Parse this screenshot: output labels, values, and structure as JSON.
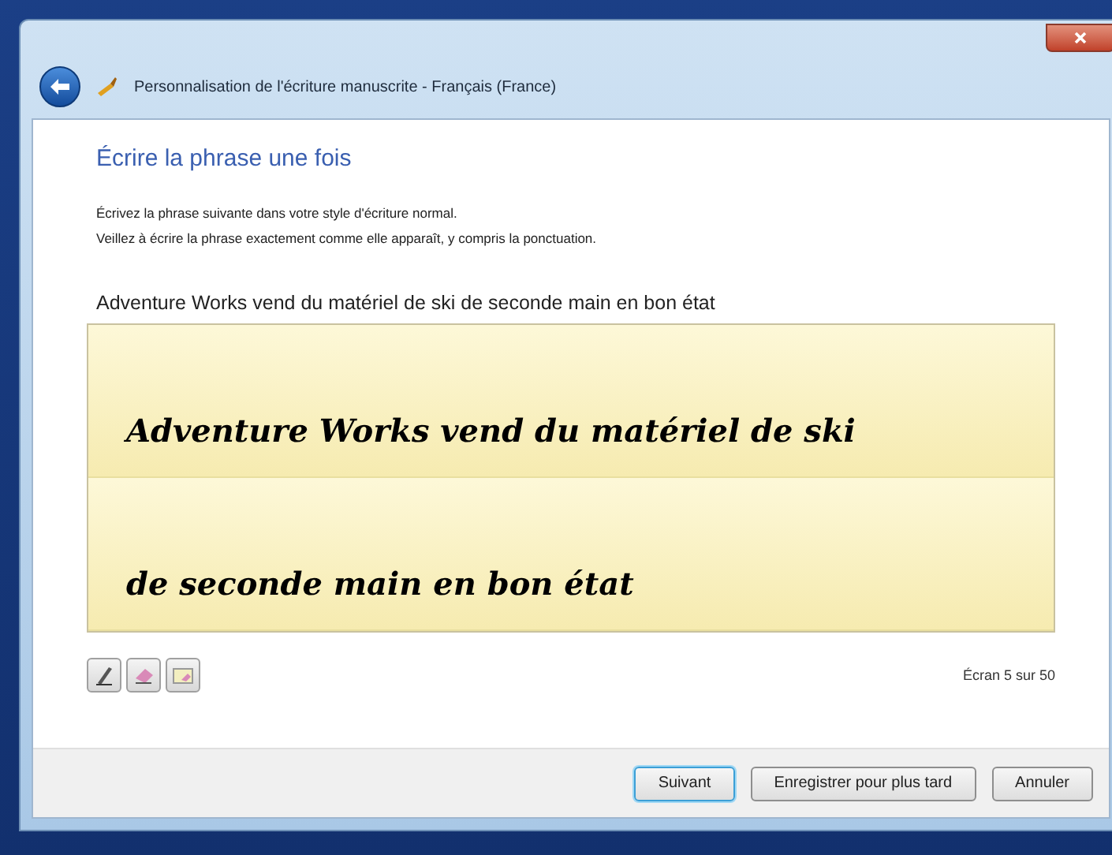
{
  "window": {
    "title": "Personnalisation de l'écriture manuscrite - Français (France)"
  },
  "heading": "Écrire la phrase une fois",
  "instructions": [
    "Écrivez la phrase suivante dans votre style d'écriture normal.",
    "Veillez à écrire la phrase exactement comme elle apparaît, y compris la ponctuation."
  ],
  "sentence": "Adventure Works vend du matériel de ski de seconde main en bon état",
  "ink_lines": [
    "Adventure Works vend du matériel de ski",
    "de seconde main en bon état"
  ],
  "tools": [
    {
      "kind": "pen",
      "selected": false
    },
    {
      "kind": "eraser",
      "selected": false
    },
    {
      "kind": "clear",
      "selected": false
    }
  ],
  "screen_counter": "Écran 5 sur 50",
  "buttons": [
    {
      "label": "Suivant",
      "default": true
    },
    {
      "label": "Enregistrer pour plus tard",
      "default": false
    },
    {
      "label": "Annuler",
      "default": false
    }
  ]
}
